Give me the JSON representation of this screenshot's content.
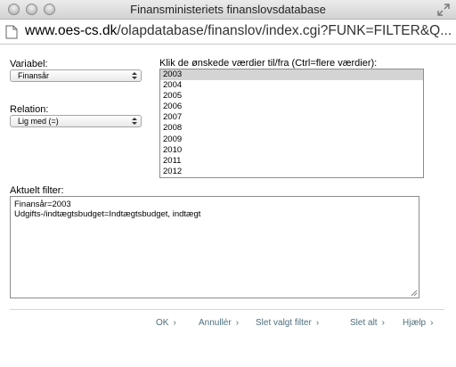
{
  "window": {
    "title": "Finansministeriets finanslovsdatabase"
  },
  "address": {
    "domain": "www.oes-cs.dk",
    "path": "/olapdatabase/finanslov/index.cgi?FUNK=FILTER&Q..."
  },
  "form": {
    "variable_label": "Variabel:",
    "variable_value": "Finansår",
    "relation_label": "Relation:",
    "relation_value": "Lig med (=)",
    "values_label": "Klik de ønskede værdier til/fra (Ctrl=flere værdier):",
    "values": [
      "2003",
      "2004",
      "2005",
      "2006",
      "2007",
      "2008",
      "2009",
      "2010",
      "2011",
      "2012"
    ],
    "selected_value": "2003",
    "filter_label": "Aktuelt filter:",
    "filter_lines": [
      "Finansår=2003",
      "Udgifts-/indtægtsbudget=Indtægtsbudget, indtægt"
    ]
  },
  "buttons": {
    "ok": "OK",
    "cancel": "Annullér",
    "delete_selected": "Slet valgt filter",
    "delete_all": "Slet alt",
    "help": "Hjælp",
    "chevron": "›"
  },
  "colors": {
    "button_text": "#4f6f7b",
    "selected_row": "#d4d4d4"
  }
}
